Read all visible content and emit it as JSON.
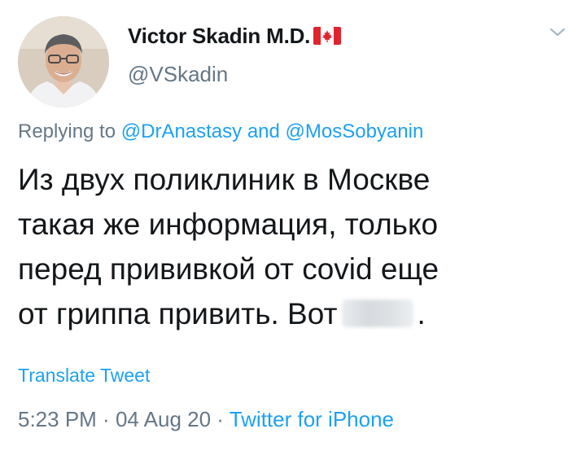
{
  "tweet": {
    "display_name": "Victor Skadin M.D.",
    "handle": "@VSkadin",
    "replying_prefix": "Replying to ",
    "mentions": [
      "@DrAnastasy",
      "@MosSobyanin"
    ],
    "mention_separator": " and ",
    "body_lines": [
      "Из двух поликлиник в Москве",
      "такая же информация, только",
      "перед прививкой от covid еще",
      "от гриппа привить. Вот"
    ],
    "body_end": ".",
    "translate_label": "Translate Tweet",
    "time": "5:23 PM",
    "separator": " · ",
    "date": "04 Aug 20",
    "source": "Twitter for iPhone"
  },
  "icons": {
    "flag": "canada-flag-icon",
    "menu": "chevron-down-icon",
    "avatar": "avatar"
  },
  "colors": {
    "link": "#1da1f2",
    "secondary": "#657786",
    "text": "#14171a",
    "flag_red": "#e0232e"
  }
}
